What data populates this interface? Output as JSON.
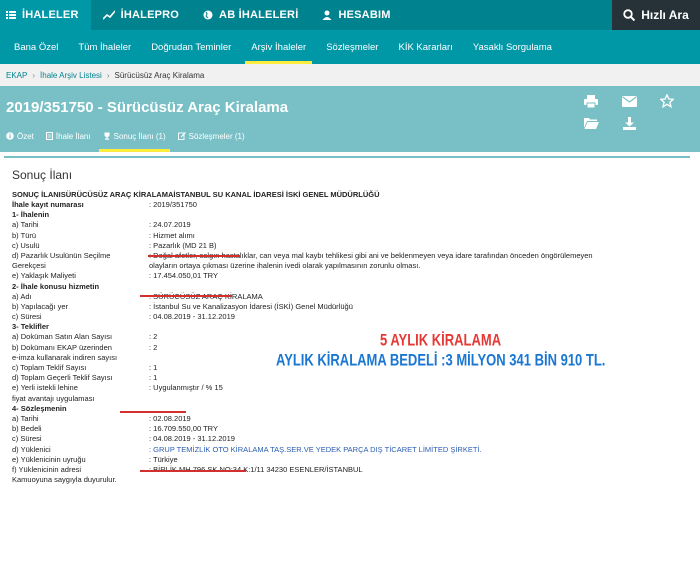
{
  "topnav": {
    "items": [
      "İHALELER",
      "İHALEPRO",
      "AB İHALELERİ",
      "HESABIM"
    ],
    "quick_search": "Hızlı Ara"
  },
  "subnav": {
    "items": [
      "Bana Özel",
      "Tüm İhaleler",
      "Doğrudan Teminler",
      "Arşiv İhaleler",
      "Sözleşmeler",
      "KİK Kararları",
      "Yasaklı Sorgulama"
    ],
    "active": "Arşiv İhaleler"
  },
  "breadcrumb": {
    "items": [
      "EKAP",
      "İhale Arşiv Listesi",
      "Sürücüsüz Araç Kiralama"
    ]
  },
  "header": {
    "title": "2019/351750 - Sürücüsüz Araç Kiralama",
    "tabs": [
      "Özet",
      "İhale İlanı",
      "Sonuç İlanı (1)",
      "Sözleşmeler (1)"
    ],
    "active_tab": "Sonuç İlanı (1)",
    "action_icons": [
      "print-icon",
      "mail-icon",
      "star-icon",
      "folder-open-icon",
      "download-icon"
    ]
  },
  "panel": {
    "title": "Sonuç İlanı",
    "subject": "SONUÇ İLANISÜRÜCÜSÜZ ARAÇ KİRALAMAİSTANBUL SU KANAL İDARESİ İSKİ GENEL MÜDÜRLÜĞÜ",
    "rows": [
      {
        "label": "İhale kayıt numarası",
        "value": ": 2019/351750",
        "section": true
      },
      {
        "label": "1- İhalenin",
        "value": "",
        "section": true
      },
      {
        "label": "a) Tarihi",
        "value": ": 24.07.2019"
      },
      {
        "label": "b) Türü",
        "value": ": Hizmet alımı"
      },
      {
        "label": "c) Usulü",
        "value": ": Pazarlık (MD 21 B)"
      },
      {
        "label": "d) Pazarlık Usulünün Seçilme",
        "value": ": Doğal afetler, salgın hastalıklar, can veya mal kaybı tehlikesi gibi ani ve beklenmeyen veya idare tarafından önceden öngörülemeyen"
      },
      {
        "label": "Gerekçesi",
        "value": "olayların ortaya çıkması üzerine ihalenin ivedi olarak yapılmasının zorunlu olması."
      },
      {
        "label": "e) Yaklaşık Maliyeti",
        "value": ": 17.454.050,01 TRY"
      },
      {
        "label": "2- İhale konusu hizmetin",
        "value": "",
        "section": true
      },
      {
        "label": "a) Adı",
        "value": ": SÜRÜCÜSÜZ ARAÇ KİRALAMA"
      },
      {
        "label": "b) Yapılacağı yer",
        "value": ": İstanbul Su ve Kanalizasyon İdaresi (İSKİ) Genel Müdürlüğü"
      },
      {
        "label": "c) Süresi",
        "value": ": 04.08.2019 - 31.12.2019"
      },
      {
        "label": "3- Teklifler",
        "value": "",
        "section": true
      },
      {
        "label": "a) Doküman Satın Alan Sayısı",
        "value": ": 2"
      },
      {
        "label": "b) Dokümanı EKAP üzerinden",
        "value": ": 2"
      },
      {
        "label": "e-imza kullanarak indiren sayısı",
        "value": ""
      },
      {
        "label": "c) Toplam Teklif Sayısı",
        "value": ": 1"
      },
      {
        "label": "d) Toplam Geçerli Teklif Sayısı",
        "value": ": 1"
      },
      {
        "label": "e) Yerli istekli lehine",
        "value": ": Uygulanmıştır / % 15"
      },
      {
        "label": "fiyat avantajı uygulaması",
        "value": ""
      },
      {
        "label": "4- Sözleşmenin",
        "value": "",
        "section": true
      },
      {
        "label": "a) Tarihi",
        "value": ": 02.08.2019"
      },
      {
        "label": "b) Bedeli",
        "value": ": 16.709.550,00 TRY"
      },
      {
        "label": "c) Süresi",
        "value": ": 04.08.2019 - 31.12.2019"
      },
      {
        "label": "d) Yüklenici",
        "value": ": GRUP TEMİZLİK OTO KİRALAMA TAŞ.SER.VE YEDEK PARÇA DIŞ TİCARET LİMİTED ŞİRKETİ.",
        "link": true
      },
      {
        "label": "e) Yüklenicinin uyruğu",
        "value": ": Türkiye"
      },
      {
        "label": "f) Yüklenicinin adresi",
        "value": ": BİRLİK MH 796 SK NO:34 K:1/11 34230 ESENLER/İSTANBUL"
      },
      {
        "label": "Kamuoyuna saygıyla duyurulur.",
        "value": ""
      }
    ]
  },
  "annotations": {
    "line1": "5 AYLIK KİRALAMA",
    "line2": "AYLIK KİRALAMA BEDELİ :3 MİLYON 341 BİN 910 TL.",
    "line1_color": "#e53935",
    "line2_color": "#1976d2"
  }
}
